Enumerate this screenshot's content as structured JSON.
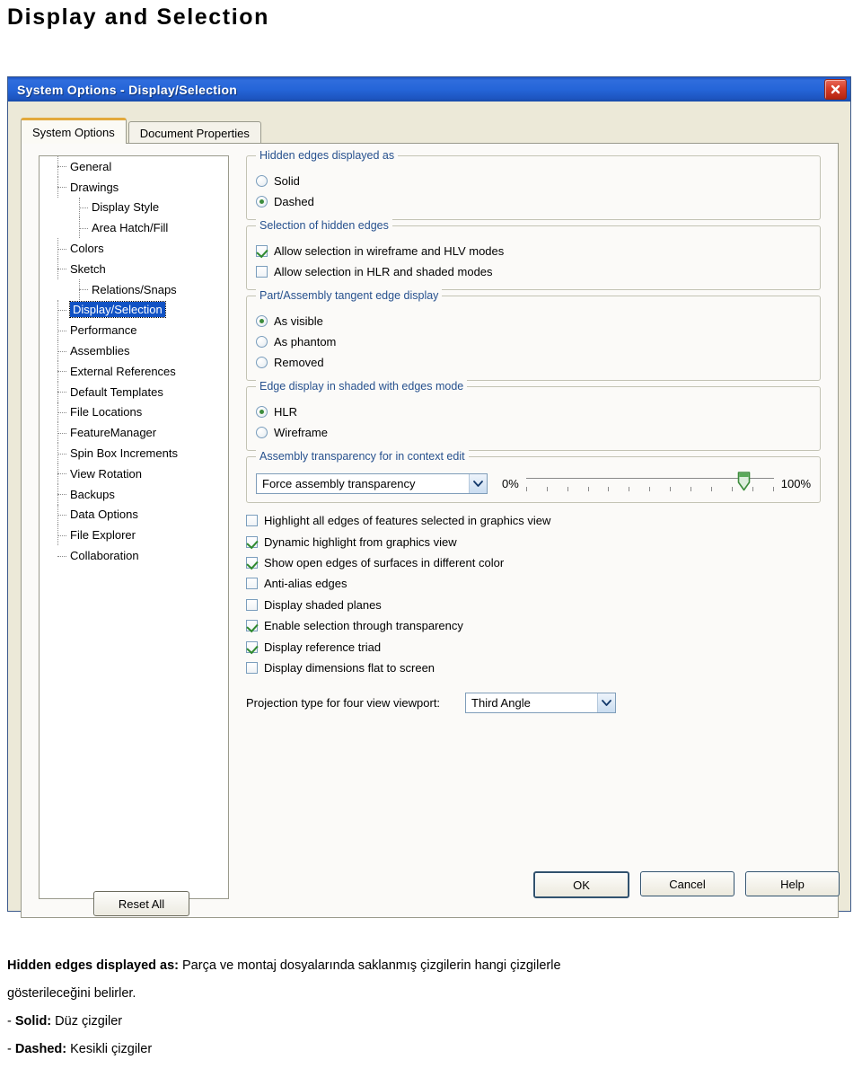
{
  "page": {
    "title": "Display and Selection"
  },
  "dialog": {
    "titlebar": {
      "app": "System Options",
      "separator": " - ",
      "page": "Display/Selection",
      "close_icon": "close-icon"
    },
    "tabs": [
      {
        "label": "System Options",
        "accel": "S",
        "active": true
      },
      {
        "label": "Document Properties",
        "accel": "D",
        "active": false
      }
    ],
    "tree": {
      "items": [
        {
          "label": "General",
          "level": 0,
          "selected": false
        },
        {
          "label": "Drawings",
          "level": 0,
          "selected": false
        },
        {
          "label": "Display Style",
          "level": 1,
          "selected": false
        },
        {
          "label": "Area Hatch/Fill",
          "level": 1,
          "selected": false
        },
        {
          "label": "Colors",
          "level": 0,
          "selected": false
        },
        {
          "label": "Sketch",
          "level": 0,
          "selected": false
        },
        {
          "label": "Relations/Snaps",
          "level": 1,
          "selected": false
        },
        {
          "label": "Display/Selection",
          "level": 0,
          "selected": true
        },
        {
          "label": "Performance",
          "level": 0,
          "selected": false
        },
        {
          "label": "Assemblies",
          "level": 0,
          "selected": false
        },
        {
          "label": "External References",
          "level": 0,
          "selected": false
        },
        {
          "label": "Default Templates",
          "level": 0,
          "selected": false
        },
        {
          "label": "File Locations",
          "level": 0,
          "selected": false
        },
        {
          "label": "FeatureManager",
          "level": 0,
          "selected": false
        },
        {
          "label": "Spin Box Increments",
          "level": 0,
          "selected": false
        },
        {
          "label": "View Rotation",
          "level": 0,
          "selected": false
        },
        {
          "label": "Backups",
          "level": 0,
          "selected": false
        },
        {
          "label": "Data Options",
          "level": 0,
          "selected": false
        },
        {
          "label": "File Explorer",
          "level": 0,
          "selected": false
        },
        {
          "label": "Collaboration",
          "level": 0,
          "selected": false
        }
      ]
    },
    "groups": {
      "hidden_edges": {
        "legend": "Hidden edges displayed as",
        "options": [
          {
            "label": "Solid",
            "accel": "S",
            "selected": false
          },
          {
            "label": "Dashed",
            "accel": "D",
            "selected": true
          }
        ]
      },
      "selection_hidden": {
        "legend": "Selection of hidden edges",
        "options": [
          {
            "label": "Allow selection in wireframe and HLV modes",
            "checked": true
          },
          {
            "label": "Allow selection in HLR and shaded modes",
            "checked": false
          }
        ]
      },
      "tangent_edge": {
        "legend": "Part/Assembly tangent edge display",
        "options": [
          {
            "label": "As visible",
            "selected": true
          },
          {
            "label": "As phantom",
            "selected": false
          },
          {
            "label": "Removed",
            "selected": false
          }
        ]
      },
      "edge_display": {
        "legend": "Edge display in shaded with edges mode",
        "options": [
          {
            "label": "HLR",
            "selected": true
          },
          {
            "label": "Wireframe",
            "selected": false
          }
        ]
      },
      "assembly_transparency": {
        "legend": "Assembly transparency for in context edit",
        "combo_value": "Force assembly transparency",
        "min_label": "0%",
        "max_label": "100%",
        "slider_percent": 88,
        "tick_count": 13
      }
    },
    "checkbox_list": [
      {
        "label": "Highlight all edges of features selected in graphics view",
        "checked": false
      },
      {
        "label": "Dynamic highlight from graphics view",
        "checked": true
      },
      {
        "label": "Show open edges of surfaces in different color",
        "checked": true
      },
      {
        "label": "Anti-alias edges",
        "checked": false
      },
      {
        "label": "Display shaded planes",
        "checked": false
      },
      {
        "label": "Enable selection through transparency",
        "checked": true
      },
      {
        "label": "Display reference triad",
        "checked": true
      },
      {
        "label": "Display dimensions flat to screen",
        "checked": false
      }
    ],
    "projection": {
      "label": "Projection type for four view viewport:",
      "value": "Third Angle"
    },
    "reset_button": "Reset All",
    "footer_buttons": [
      {
        "label": "OK",
        "default": true
      },
      {
        "label": "Cancel",
        "default": false
      },
      {
        "label": "Help",
        "default": false
      }
    ]
  },
  "caption": {
    "line1_bold": "Hidden edges displayed as:",
    "line1_rest": " Parça ve montaj dosyalarında saklanmış çizgilerin hangi çizgilerle",
    "line2": "gösterileceğini belirler.",
    "bullet1_dash": "- ",
    "bullet1_bold": "Solid:",
    "bullet1_rest": " Düz çizgiler",
    "bullet2_dash": "- ",
    "bullet2_bold": "Dashed:",
    "bullet2_rest": " Kesikli çizgiler"
  }
}
